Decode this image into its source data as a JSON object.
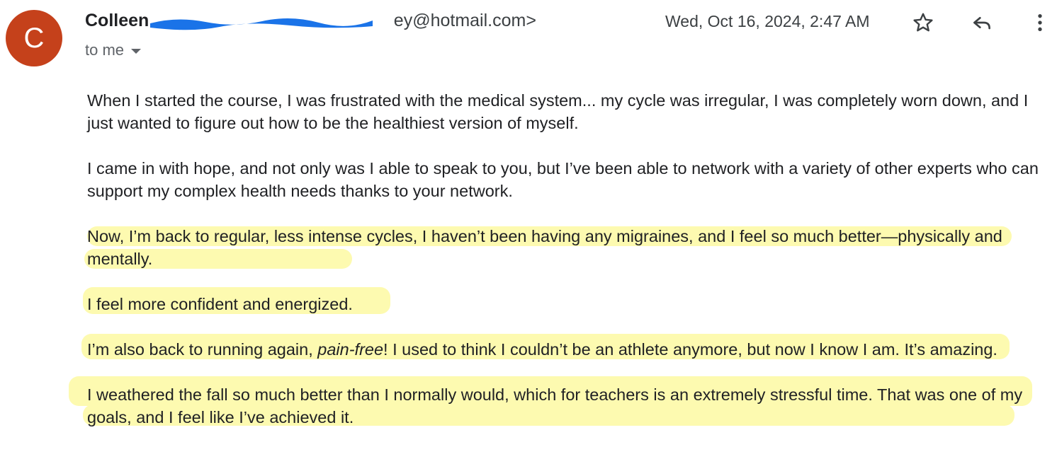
{
  "colors": {
    "avatar_bg": "#c5411b",
    "highlight": "#fdfab0",
    "redaction": "#1a73e8"
  },
  "sender": {
    "avatar_letter": "C",
    "name": "Colleen",
    "email_visible": "ey@hotmail.com>"
  },
  "recipient_label": "to me",
  "date": "Wed, Oct 16, 2024, 2:47 AM",
  "icons": {
    "star": "star-icon",
    "reply": "reply-icon",
    "more": "more-vert-icon"
  },
  "paragraphs": [
    {
      "text": "When I started the course, I was frustrated with the medical system... my cycle was irregular, I was completely worn down, and I just wanted to figure out how to be the healthiest version of myself."
    },
    {
      "text": "I came in with hope, and not only was I able to speak to you, but I’ve been able to network with a variety of other experts who can support my complex health needs thanks to your network."
    },
    {
      "text": "Now, I’m back to regular, less intense cycles, I haven’t been having any migraines, and I feel so much better—physically and mentally.",
      "highlighted": true
    },
    {
      "text": "I feel more confident and energized.",
      "highlighted": true
    },
    {
      "before": "I’m also back to running again, ",
      "emphasis": "pain-free",
      "after": "! I used to think I couldn’t be an athlete anymore, but now I know I am. It’s amazing.",
      "highlighted": true
    },
    {
      "text": "I weathered the fall so much better than I normally would, which for teachers is an extremely stressful time. That was one of my goals, and I feel like I’ve achieved it.",
      "highlighted": true
    }
  ]
}
